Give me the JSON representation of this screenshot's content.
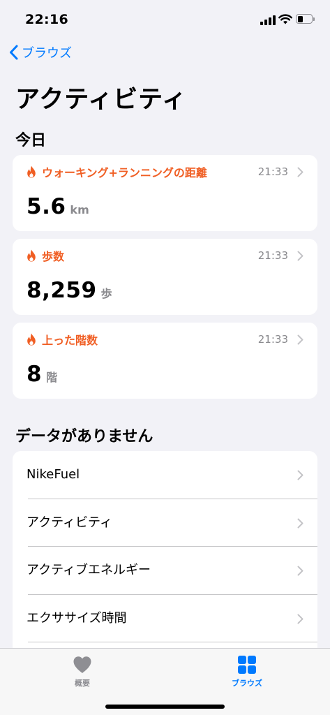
{
  "status_bar": {
    "time": "22:16"
  },
  "nav": {
    "back_label": "ブラウズ"
  },
  "page": {
    "title": "アクティビティ"
  },
  "sections": {
    "today": "今日",
    "no_data": "データがありません"
  },
  "colors": {
    "accent": "#f05e23",
    "link": "#007aff"
  },
  "today_cards": [
    {
      "title": "ウォーキング+ランニングの距離",
      "time": "21:33",
      "value": "5.6",
      "unit": "km",
      "icon": "flame-icon"
    },
    {
      "title": "歩数",
      "time": "21:33",
      "value": "8,259",
      "unit": "歩",
      "icon": "flame-icon"
    },
    {
      "title": "上った階数",
      "time": "21:33",
      "value": "8",
      "unit": "階",
      "icon": "flame-icon"
    }
  ],
  "no_data_items": [
    {
      "label": "NikeFuel"
    },
    {
      "label": "アクティビティ"
    },
    {
      "label": "アクティブエネルギー"
    },
    {
      "label": "エクササイズ時間"
    }
  ],
  "tab_bar": {
    "summary": {
      "label": "概要",
      "icon": "heart-icon"
    },
    "browse": {
      "label": "ブラウズ",
      "icon": "grid-icon"
    }
  }
}
